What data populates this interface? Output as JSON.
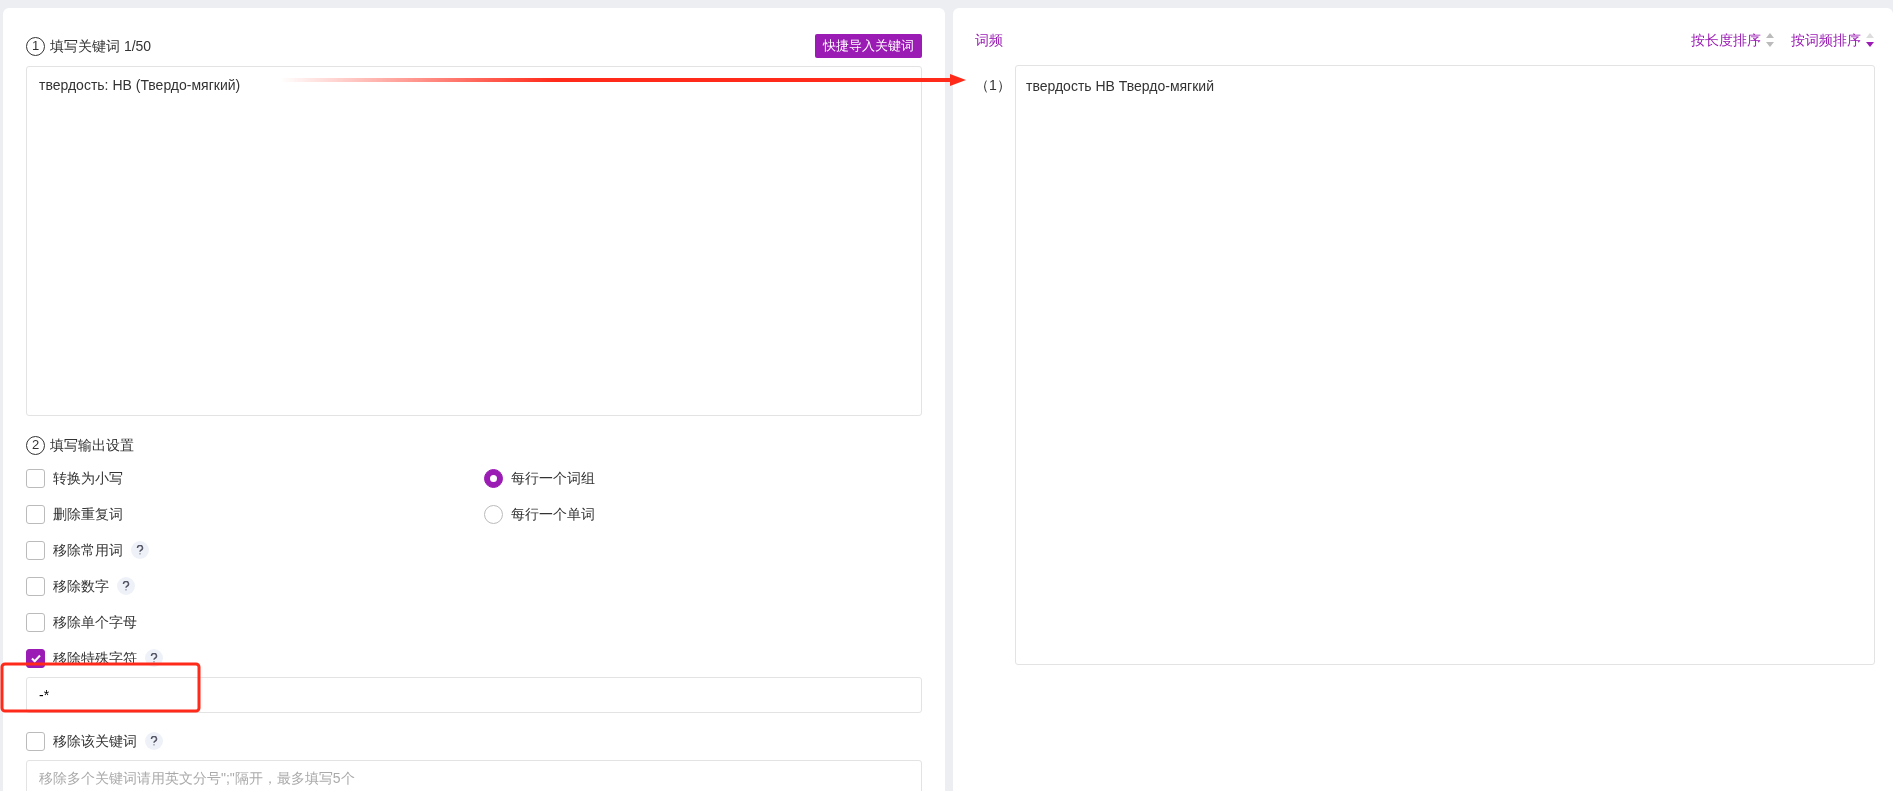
{
  "keywords_panel": {
    "step_number": "1",
    "title": "填写关键词 1/50",
    "import_button": "快捷导入关键词",
    "input_text": "твердость: HB (Твердо-мягкий)"
  },
  "settings": {
    "step_number": "2",
    "title": "填写输出设置",
    "options": [
      {
        "kind": "checkbox",
        "label": "转换为小写",
        "checked": false,
        "help": false
      },
      {
        "kind": "checkbox",
        "label": "删除重复词",
        "checked": false,
        "help": false
      },
      {
        "kind": "checkbox",
        "label": "移除常用词",
        "checked": false,
        "help": true
      },
      {
        "kind": "checkbox",
        "label": "移除数字",
        "checked": false,
        "help": true
      },
      {
        "kind": "checkbox",
        "label": "移除单个字母",
        "checked": false,
        "help": false
      },
      {
        "kind": "checkbox",
        "label": "移除特殊字符",
        "checked": true,
        "help": true
      },
      {
        "kind": "field",
        "value": "-*"
      },
      {
        "kind": "checkbox",
        "label": "移除该关键词",
        "checked": false,
        "help": true
      },
      {
        "kind": "field",
        "placeholder": "移除多个关键词请用英文分号\";\"隔开，最多填写5个"
      }
    ],
    "radios": [
      {
        "label": "每行一个词组",
        "selected": true
      },
      {
        "label": "每行一个单词",
        "selected": false
      }
    ]
  },
  "result_panel": {
    "title": "词频",
    "sorts": [
      {
        "label": "按长度排序",
        "selected": false
      },
      {
        "label": "按词频排序",
        "selected": true
      }
    ],
    "rows": [
      {
        "index": "（1）",
        "text": "твердость HB Твердо-мягкий"
      }
    ]
  },
  "annotations": {
    "arrow": true,
    "highlight_box": true
  }
}
